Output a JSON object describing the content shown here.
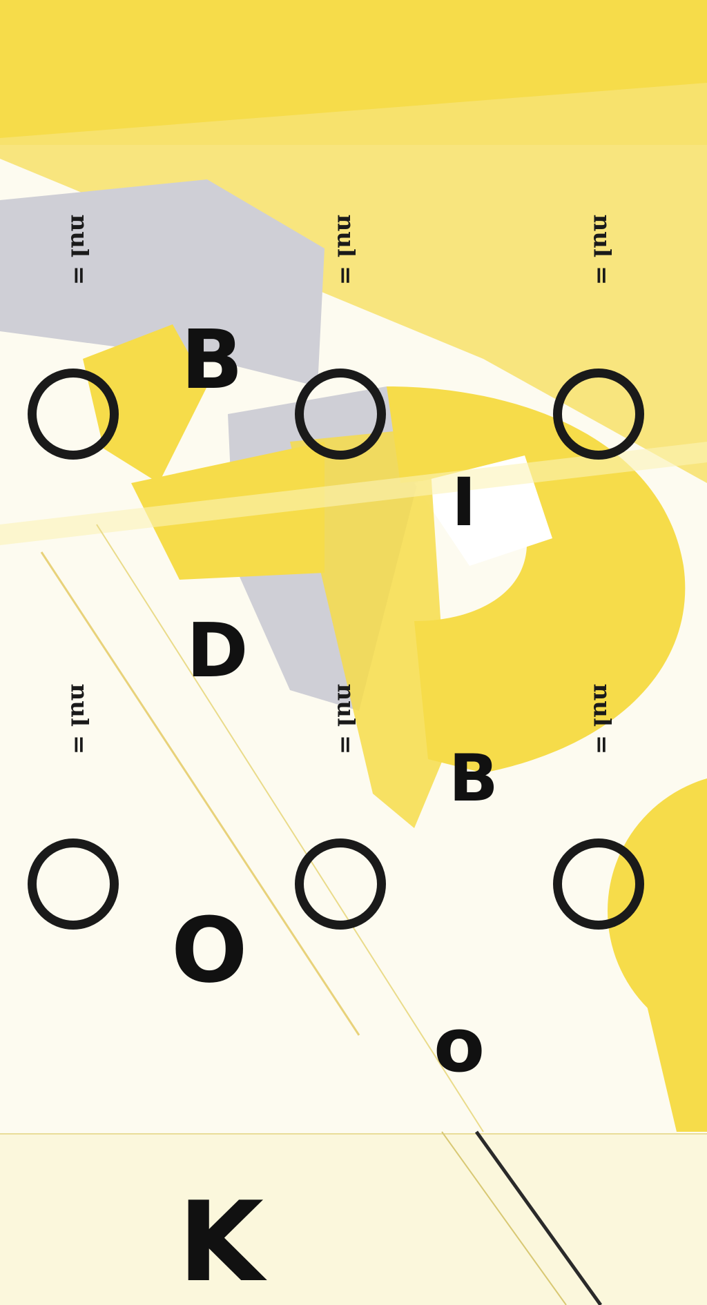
{
  "colors": {
    "yellow": "#f6dc4a",
    "pale_yellow": "#faf1a8",
    "grey": "#cfcfd6",
    "ink": "#111111",
    "strip": "#fbf7dc"
  },
  "title_letters": {
    "b1": "B",
    "i": "I",
    "d": "D",
    "b2": "B",
    "o1": "O",
    "o2": "o",
    "k": "K"
  },
  "toggles": [
    {
      "label": "nul =",
      "icon": "ring-icon"
    },
    {
      "label": "nul =",
      "icon": "ring-icon"
    },
    {
      "label": "nul =",
      "icon": "ring-icon"
    },
    {
      "label": "nul =",
      "icon": "ring-icon"
    },
    {
      "label": "nul =",
      "icon": "ring-icon"
    },
    {
      "label": "nul =",
      "icon": "ring-icon"
    }
  ]
}
